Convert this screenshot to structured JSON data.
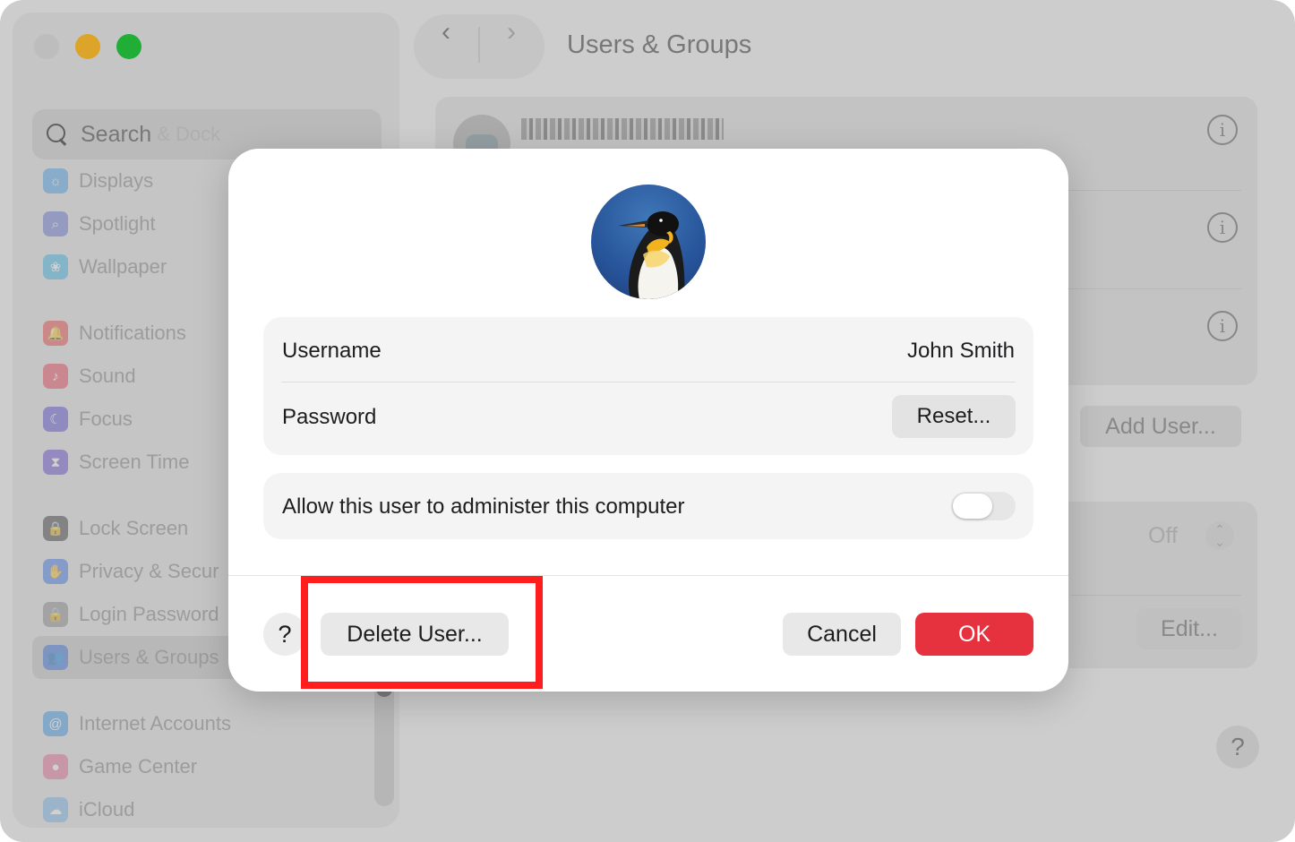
{
  "window": {
    "title": "Users & Groups",
    "nav_back": "‹",
    "nav_forward": "›"
  },
  "sidebar": {
    "search_placeholder": "Search",
    "search_ghost": "& Dock",
    "items": [
      {
        "label": "Displays",
        "color": "#4aa3f0",
        "icon": "sun-icon"
      },
      {
        "label": "Spotlight",
        "color": "#6b7bd6",
        "icon": "magnifier-icon"
      },
      {
        "label": "Wallpaper",
        "color": "#3fb7e8",
        "icon": "flower-icon"
      },
      {
        "label": "Notifications",
        "color": "#f04a4a",
        "icon": "bell-icon"
      },
      {
        "label": "Sound",
        "color": "#f0485e",
        "icon": "speaker-icon"
      },
      {
        "label": "Focus",
        "color": "#5b4fd6",
        "icon": "moon-icon"
      },
      {
        "label": "Screen Time",
        "color": "#6b4fd6",
        "icon": "hourglass-icon"
      },
      {
        "label": "Lock Screen",
        "color": "#3c3c3c",
        "icon": "lock-icon"
      },
      {
        "label": "Privacy & Secur",
        "color": "#3f7de8",
        "icon": "hand-icon"
      },
      {
        "label": "Login Password",
        "color": "#8e8e8e",
        "icon": "padlock-icon"
      },
      {
        "label": "Users & Groups",
        "color": "#3f7de8",
        "icon": "users-icon"
      },
      {
        "label": "Internet Accounts",
        "color": "#3f9be8",
        "icon": "at-icon"
      },
      {
        "label": "Game Center",
        "color": "#e86f9b",
        "icon": "game-center-icon"
      },
      {
        "label": "iCloud",
        "color": "#7ab7ee",
        "icon": "cloud-icon"
      }
    ]
  },
  "background": {
    "add_user_label": "Add User...",
    "off_value": "Off",
    "edit_label": "Edit...",
    "help_label": "?"
  },
  "dialog": {
    "username_label": "Username",
    "username_value": "John Smith",
    "password_label": "Password",
    "reset_label": "Reset...",
    "admin_label": "Allow this user to administer this computer",
    "admin_enabled": false,
    "help_label": "?",
    "delete_label": "Delete User...",
    "cancel_label": "Cancel",
    "ok_label": "OK",
    "ok_color": "#e5323e"
  },
  "highlight_color": "#ff1d1d"
}
